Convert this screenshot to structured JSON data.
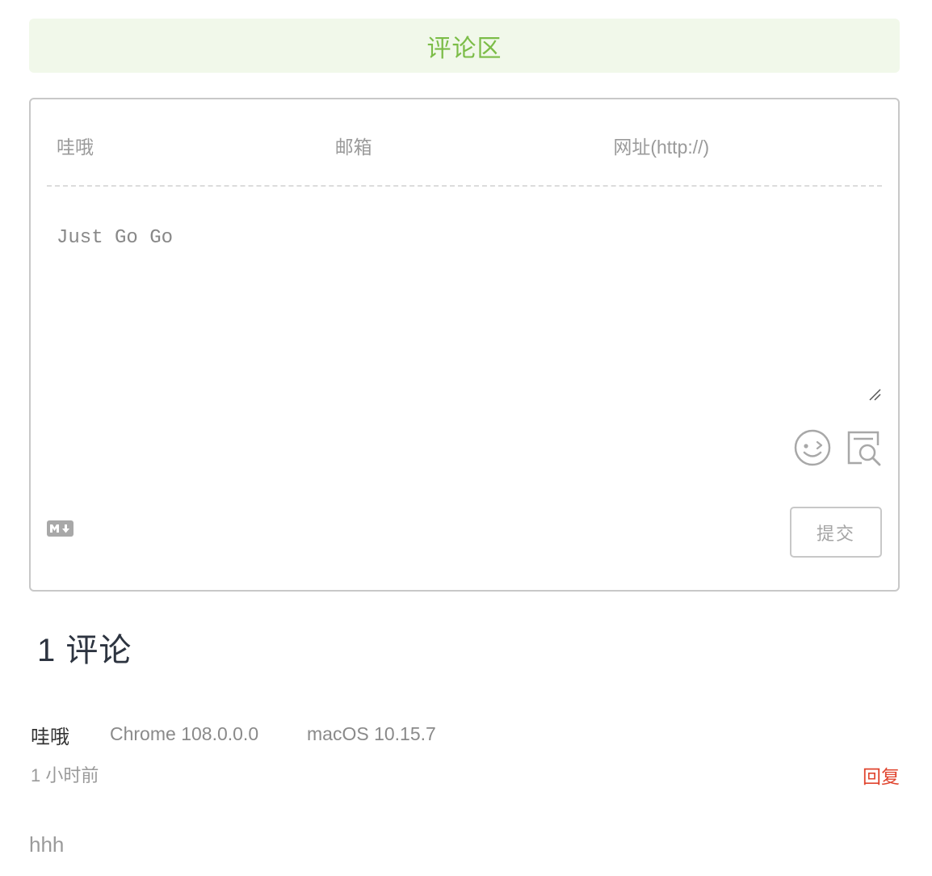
{
  "banner": {
    "title": "评论区"
  },
  "form": {
    "nick_placeholder": "哇哦",
    "mail_placeholder": "邮箱",
    "link_placeholder": "网址(http://)",
    "editor_placeholder": "Just Go Go",
    "submit_label": "提交",
    "icons": [
      "emoji-icon",
      "preview-icon",
      "markdown-icon"
    ]
  },
  "comments": {
    "count_label": "1 评论",
    "items": [
      {
        "author": "哇哦",
        "browser": "Chrome 108.0.0.0",
        "os": "macOS 10.15.7",
        "time": "1 小时前",
        "reply_label": "回复",
        "body": "hhh"
      }
    ]
  },
  "colors": {
    "accent_green": "#7cbd48",
    "banner_bg": "#f1f8ea",
    "reply_red": "#e0452f"
  }
}
